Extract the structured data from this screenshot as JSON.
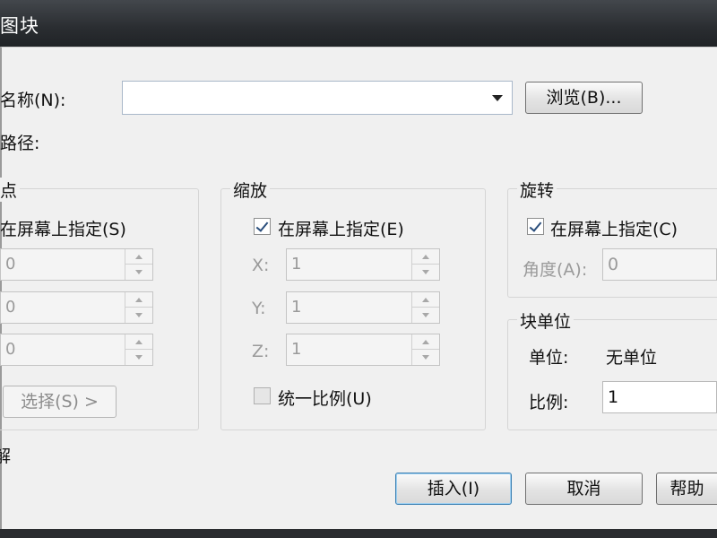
{
  "window": {
    "title": "图块"
  },
  "name": {
    "label": "名称(N):",
    "value": "",
    "browse_label": "浏览(B)..."
  },
  "path": {
    "label": "路径:"
  },
  "insertion": {
    "legend": "点",
    "on_screen_label": "在屏幕上指定(S)",
    "x": "0",
    "y": "0",
    "z": "0",
    "pick_label": "选择(S) >"
  },
  "scale": {
    "legend": "缩放",
    "on_screen_label": "在屏幕上指定(E)",
    "x_label": "X:",
    "y_label": "Y:",
    "z_label": "Z:",
    "x": "1",
    "y": "1",
    "z": "1",
    "uniform_label": "统一比例(U)"
  },
  "rotation": {
    "legend": "旋转",
    "on_screen_label": "在屏幕上指定(C)",
    "angle_label": "角度(A):",
    "angle": "0"
  },
  "block_unit": {
    "legend": "块单位",
    "unit_label": "单位:",
    "unit_value": "无单位",
    "factor_label": "比例:",
    "factor_value": "1"
  },
  "explode": {
    "label": "解"
  },
  "buttons": {
    "insert": "插入(I)",
    "cancel": "取消",
    "help": "帮助"
  }
}
